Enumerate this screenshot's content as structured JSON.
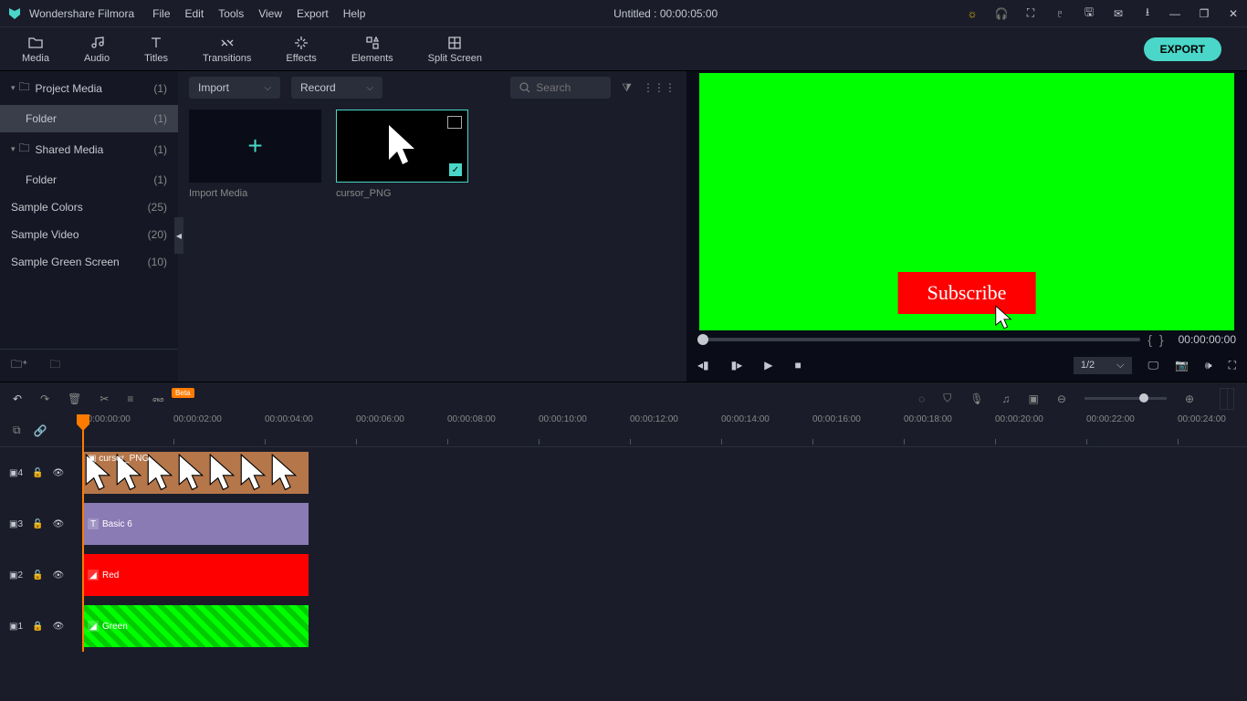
{
  "app": {
    "name": "Wondershare Filmora",
    "title_center": "Untitled : 00:00:05:00"
  },
  "menu": [
    "File",
    "Edit",
    "Tools",
    "View",
    "Export",
    "Help"
  ],
  "tabs": [
    {
      "label": "Media"
    },
    {
      "label": "Audio"
    },
    {
      "label": "Titles"
    },
    {
      "label": "Transitions"
    },
    {
      "label": "Effects"
    },
    {
      "label": "Elements"
    },
    {
      "label": "Split Screen"
    }
  ],
  "export_label": "EXPORT",
  "sidebar": {
    "items": [
      {
        "label": "Project Media",
        "count": "(1)",
        "expandable": true
      },
      {
        "label": "Folder",
        "count": "(1)",
        "child": true,
        "selected": true
      },
      {
        "label": "Shared Media",
        "count": "(1)",
        "expandable": true
      },
      {
        "label": "Folder",
        "count": "(1)",
        "child": true
      },
      {
        "label": "Sample Colors",
        "count": "(25)"
      },
      {
        "label": "Sample Video",
        "count": "(20)"
      },
      {
        "label": "Sample Green Screen",
        "count": "(10)"
      }
    ]
  },
  "media": {
    "import_label": "Import",
    "record_label": "Record",
    "search_placeholder": "Search",
    "import_media_label": "Import Media",
    "item1_label": "cursor_PNG"
  },
  "preview": {
    "subscribe_label": "Subscribe",
    "scrub_time": "00:00:00:00",
    "ratio": "1/2"
  },
  "timeline": {
    "beta": "Beta",
    "ruler_ticks": [
      "00:00:00:00",
      "00:00:02:00",
      "00:00:04:00",
      "00:00:06:00",
      "00:00:08:00",
      "00:00:10:00",
      "00:00:12:00",
      "00:00:14:00",
      "00:00:16:00",
      "00:00:18:00",
      "00:00:20:00",
      "00:00:22:00",
      "00:00:24:00"
    ],
    "tracks": [
      {
        "name": "4",
        "clip_label": "cursor_PNG"
      },
      {
        "name": "3",
        "clip_label": "Basic 6"
      },
      {
        "name": "2",
        "clip_label": "Red"
      },
      {
        "name": "1",
        "clip_label": "Green"
      }
    ]
  }
}
